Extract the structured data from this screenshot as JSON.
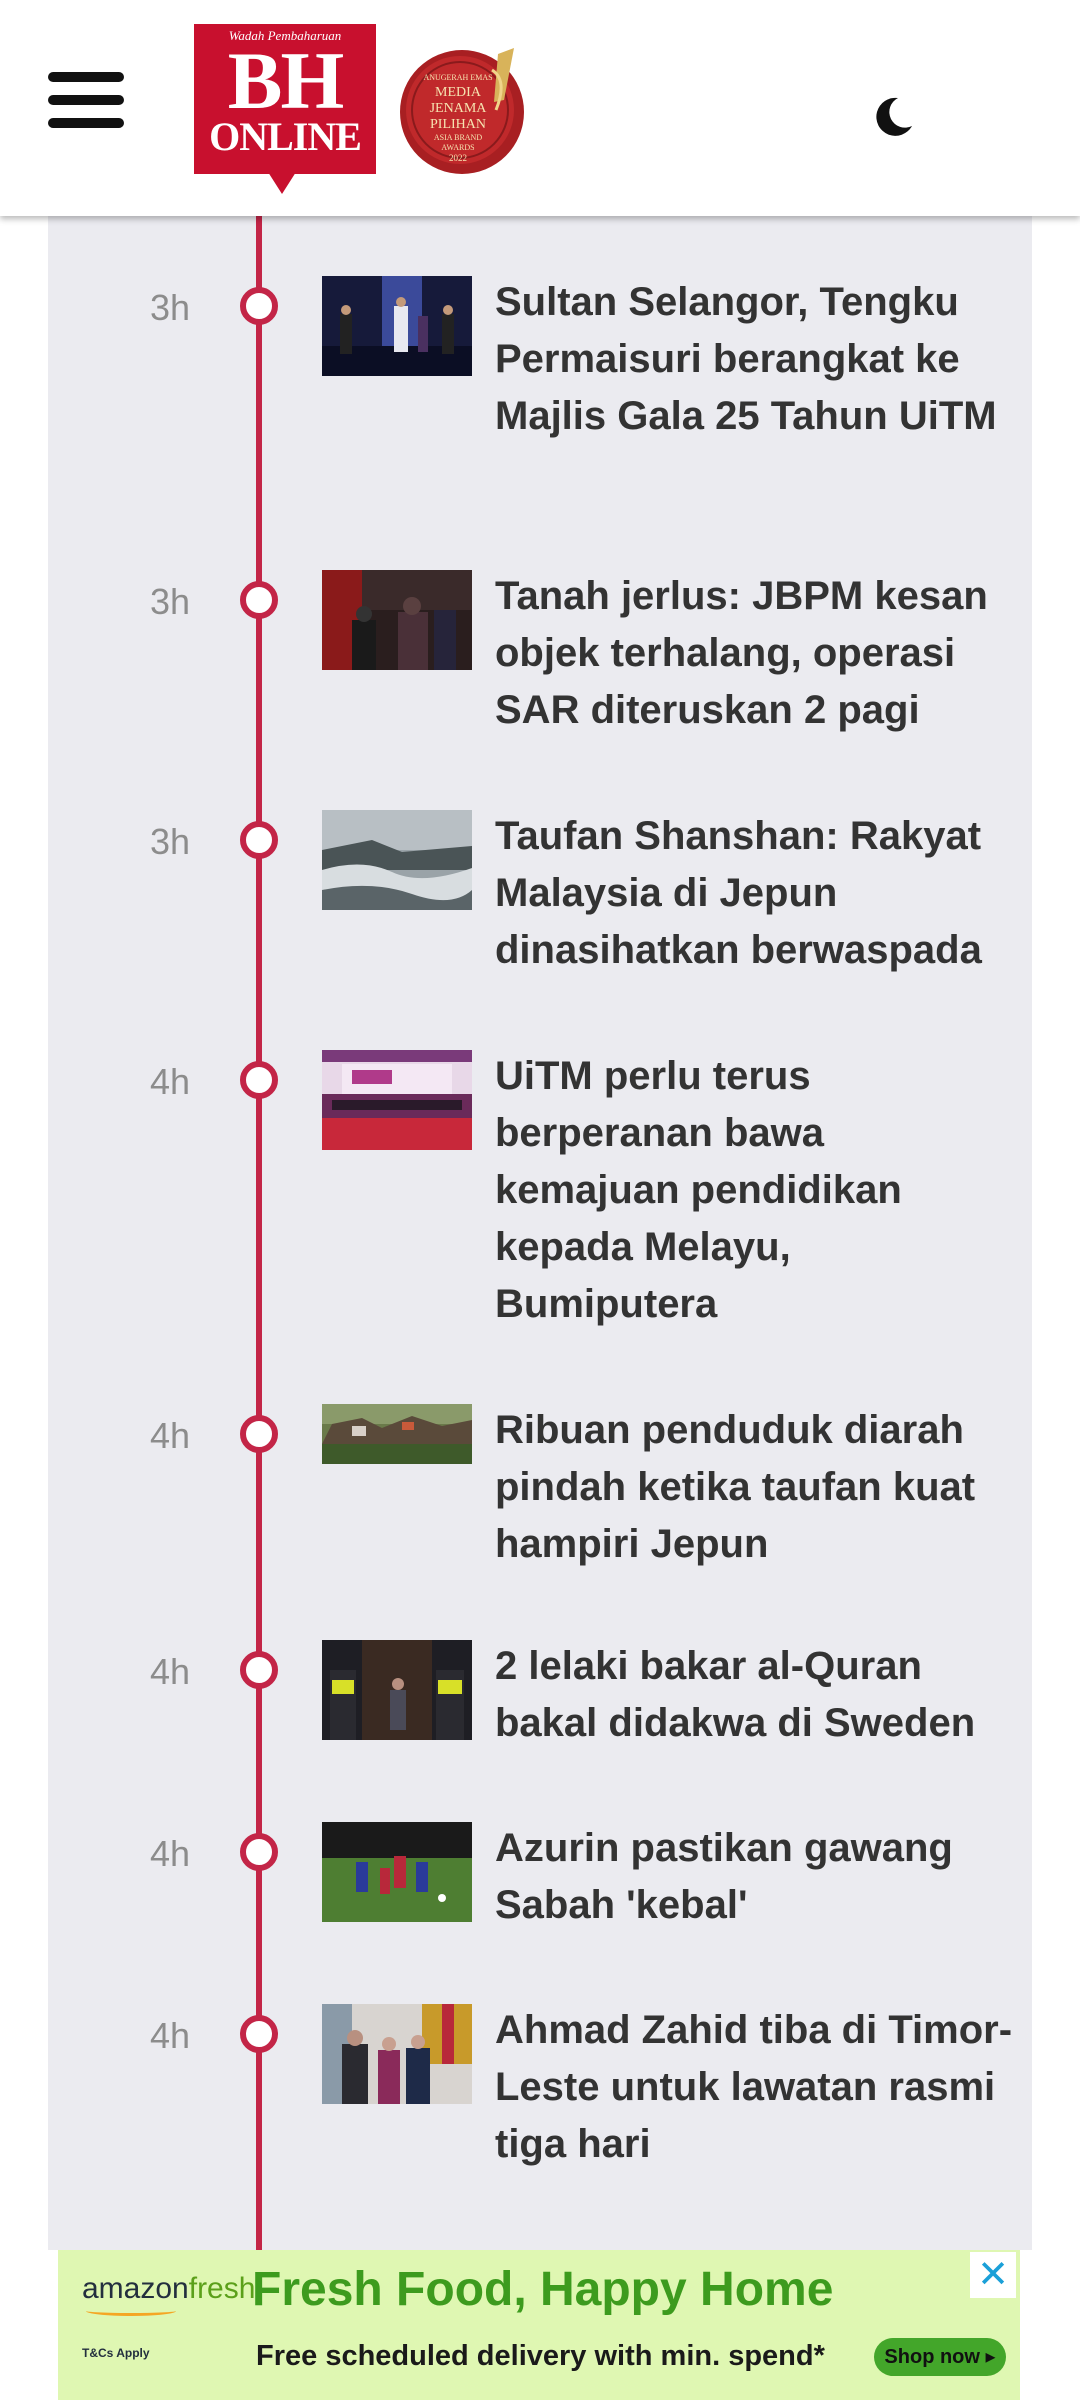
{
  "header": {
    "logo_tagline": "Wadah Pembaharuan",
    "logo_main": "BH",
    "logo_sub": "ONLINE",
    "award_lines": [
      "ANUGERAH EMAS",
      "MEDIA",
      "JENAMA",
      "PILIHAN",
      "ASIA BRAND",
      "AWARDS",
      "2022"
    ],
    "menu_icon": "hamburger-menu-icon",
    "theme_icon": "moon-icon"
  },
  "colors": {
    "accent": "#c32547",
    "brand_red": "#c8102e",
    "panel_bg": "#ebebf0",
    "title_text": "#333333",
    "time_text": "#8c8c8c"
  },
  "feed": [
    {
      "time": "3h",
      "title": "Sultan Selangor, Tengku Permaisuri berangkat ke Majlis Gala 25 Tahun UiTM"
    },
    {
      "time": "3h",
      "title": "Tanah jerlus: JBPM kesan objek terhalang, operasi SAR diteruskan 2 pagi"
    },
    {
      "time": "3h",
      "title": "Taufan Shanshan: Rakyat Malaysia di Jepun dinasihatkan berwaspada"
    },
    {
      "time": "4h",
      "title": "UiTM perlu terus berperanan bawa kemajuan pendidikan kepada Melayu, Bumiputera"
    },
    {
      "time": "4h",
      "title": "Ribuan penduduk diarah pindah ketika taufan kuat hampiri Jepun"
    },
    {
      "time": "4h",
      "title": "2 lelaki bakar al-Quran bakal didakwa di Sweden"
    },
    {
      "time": "4h",
      "title": "Azurin pastikan gawang Sabah 'kebal'"
    },
    {
      "time": "4h",
      "title": "Ahmad Zahid tiba di Timor-Leste untuk lawatan rasmi tiga hari"
    }
  ],
  "ad": {
    "brand_prefix": "amazon",
    "brand_suffix": "fresh",
    "fine_print": "T&Cs Apply",
    "headline": "Fresh Food, Happy Home",
    "subline": "Free scheduled delivery with min. spend*",
    "cta": "Shop now ▸",
    "close": "✕"
  }
}
